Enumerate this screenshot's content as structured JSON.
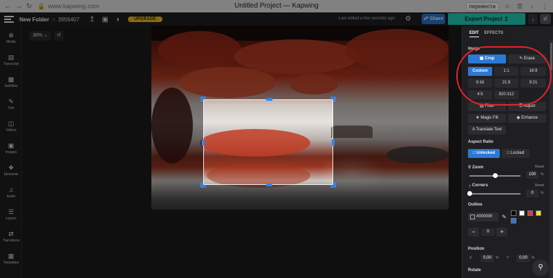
{
  "browser": {
    "url": "www.kapwing.com",
    "title": "Untitled Project — Kapwing",
    "translate_chip": "перевести",
    "icons": [
      "back-icon",
      "forward-icon",
      "reload-icon",
      "lock-icon",
      "star-icon",
      "extensions-icon",
      "download-icon",
      "menu-icon"
    ]
  },
  "appbar": {
    "folder": "New Folder",
    "separator": ">",
    "project_id": "3956407",
    "upgrade_label": "UPGRADE",
    "last_edited": "Last edited a few seconds ago",
    "share_label": "Share",
    "export_label": "Export Project",
    "avatar_letter": "И"
  },
  "sidebar": {
    "items": [
      {
        "label": "Media",
        "icon": "plus-icon"
      },
      {
        "label": "Transcript",
        "icon": "transcript-icon"
      },
      {
        "label": "Subtitles",
        "icon": "subtitles-icon"
      },
      {
        "label": "Text",
        "icon": "text-icon"
      },
      {
        "label": "Videos",
        "icon": "video-icon"
      },
      {
        "label": "Images",
        "icon": "image-icon"
      },
      {
        "label": "Elements",
        "icon": "elements-icon"
      },
      {
        "label": "Audio",
        "icon": "audio-icon"
      },
      {
        "label": "Layers",
        "icon": "layers-icon"
      },
      {
        "label": "Transitions",
        "icon": "transitions-icon"
      },
      {
        "label": "Templates",
        "icon": "templates-icon"
      }
    ]
  },
  "canvas": {
    "zoom_label": "38%"
  },
  "panel": {
    "tab_edit": "EDIT",
    "tab_effects": "EFFECTS",
    "image_label": "Image",
    "crop_label": "Crop",
    "erase_label": "Erase",
    "ratios": [
      "Custom",
      "1:1",
      "16:9",
      "9:16",
      "21:9",
      "9:21",
      "4:5",
      "820:312"
    ],
    "selected_ratio": "Custom",
    "filter_label": "Filter",
    "adjust_label": "Adjust",
    "magic_fill_label": "Magic Fill",
    "enhance_label": "Enhance",
    "translate_text_label": "Translate Text",
    "aspect_ratio_label": "Aspect Ratio",
    "unlocked_label": "Unlocked",
    "locked_label": "Locked",
    "zoom_label": "Zoom",
    "zoom_reset": "Reset",
    "zoom_value": "100",
    "zoom_unit": "%",
    "zoom_fraction": 0.5,
    "corners_label": "Corners",
    "corners_reset": "Reset",
    "corners_value": "0",
    "corners_unit": "%",
    "corners_fraction": 0,
    "outline_label": "Outline",
    "outline_color": "#000000",
    "outline_width": "0",
    "swatches": [
      "#000000",
      "#ffffff",
      "#e0334c",
      "#f5e02a",
      "#2c78d4"
    ],
    "position_label": "Position",
    "x_label": "X",
    "x_value": "0,00",
    "x_unit": "%",
    "y_label": "Y",
    "y_value": "0,00",
    "y_unit": "%",
    "rotate_label": "Rotate"
  },
  "colors": {
    "accent_blue": "#2c78d4",
    "export_teal": "#21d8c2",
    "upgrade_yellow": "#f7c418",
    "annotation_red": "#e8242b"
  }
}
